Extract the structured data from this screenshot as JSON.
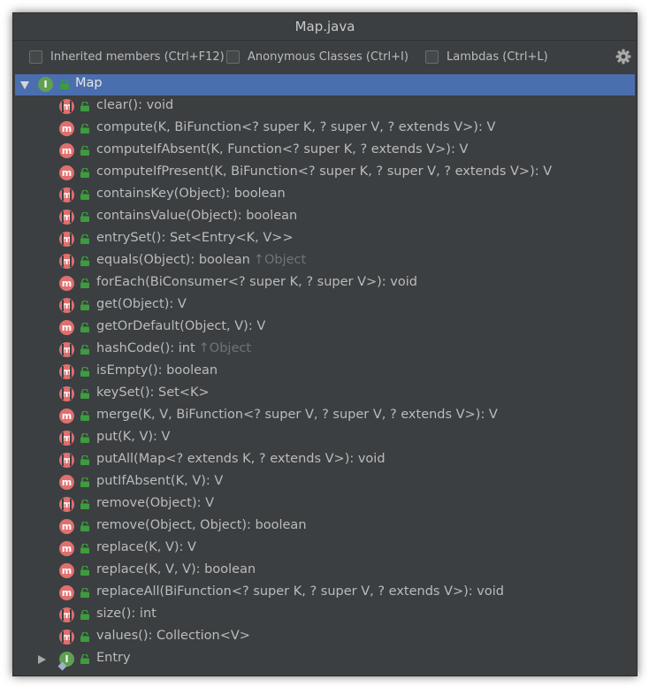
{
  "window": {
    "title": "Map.java"
  },
  "toolbar": {
    "options": [
      {
        "label": "Inherited members (Ctrl+F12)",
        "checked": false
      },
      {
        "label": "Anonymous Classes (Ctrl+I)",
        "checked": false
      },
      {
        "label": "Lambdas (Ctrl+L)",
        "checked": false
      }
    ],
    "settings_icon": "gear-icon"
  },
  "tree": {
    "root": {
      "label": "Map",
      "icon": "interface-icon",
      "expanded": true,
      "selected": true
    },
    "methods": [
      {
        "name": "clear(): void",
        "abstract": true
      },
      {
        "name": "compute(K, BiFunction<? super K, ? super V, ? extends V>): V",
        "abstract": false
      },
      {
        "name": "computeIfAbsent(K, Function<? super K, ? extends V>): V",
        "abstract": false
      },
      {
        "name": "computeIfPresent(K, BiFunction<? super K, ? super V, ? extends V>): V",
        "abstract": false
      },
      {
        "name": "containsKey(Object): boolean",
        "abstract": true
      },
      {
        "name": "containsValue(Object): boolean",
        "abstract": true
      },
      {
        "name": "entrySet(): Set<Entry<K, V>>",
        "abstract": true
      },
      {
        "name": "equals(Object): boolean",
        "abstract": true,
        "inherited": "↑Object"
      },
      {
        "name": "forEach(BiConsumer<? super K, ? super V>): void",
        "abstract": false
      },
      {
        "name": "get(Object): V",
        "abstract": true
      },
      {
        "name": "getOrDefault(Object, V): V",
        "abstract": false
      },
      {
        "name": "hashCode(): int",
        "abstract": true,
        "inherited": "↑Object"
      },
      {
        "name": "isEmpty(): boolean",
        "abstract": true
      },
      {
        "name": "keySet(): Set<K>",
        "abstract": true
      },
      {
        "name": "merge(K, V, BiFunction<? super V, ? super V, ? extends V>): V",
        "abstract": false
      },
      {
        "name": "put(K, V): V",
        "abstract": true
      },
      {
        "name": "putAll(Map<? extends K, ? extends V>): void",
        "abstract": true
      },
      {
        "name": "putIfAbsent(K, V): V",
        "abstract": false
      },
      {
        "name": "remove(Object): V",
        "abstract": true
      },
      {
        "name": "remove(Object, Object): boolean",
        "abstract": false
      },
      {
        "name": "replace(K, V): V",
        "abstract": false
      },
      {
        "name": "replace(K, V, V): boolean",
        "abstract": false
      },
      {
        "name": "replaceAll(BiFunction<? super K, ? super V, ? extends V>): void",
        "abstract": false
      },
      {
        "name": "size(): int",
        "abstract": true
      },
      {
        "name": "values(): Collection<V>",
        "abstract": true
      }
    ],
    "nested": {
      "label": "Entry",
      "icon": "interface-icon",
      "expanded": false
    }
  },
  "colors": {
    "background": "#3c3f41",
    "selection": "#4b6eaf",
    "method_icon": "#e06f6f",
    "interface_icon": "#5fa054",
    "lock_icon": "#3d9c3f"
  }
}
